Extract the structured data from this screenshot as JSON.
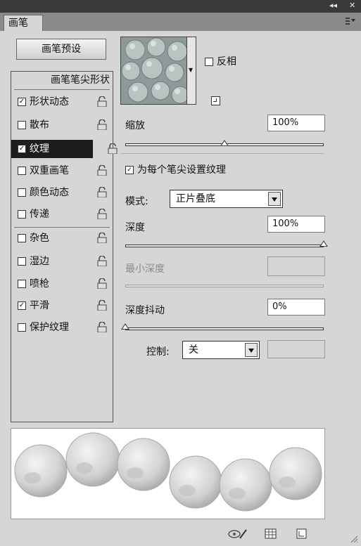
{
  "window": {
    "collapse_glyph": "◂◂",
    "close_glyph": "✕"
  },
  "tab": {
    "label": "画笔"
  },
  "menu_icon": "panel-menu-icon",
  "presets_button": "画笔预设",
  "brush_tip_header": "画笔笔尖形状",
  "options": [
    {
      "label": "形状动态",
      "checked": true
    },
    {
      "label": "散布",
      "checked": false
    },
    {
      "label": "纹理",
      "checked": true,
      "selected": true
    },
    {
      "label": "双重画笔",
      "checked": false
    },
    {
      "label": "颜色动态",
      "checked": false
    },
    {
      "label": "传递",
      "checked": false
    },
    {
      "label": "杂色",
      "checked": false
    },
    {
      "label": "湿边",
      "checked": false
    },
    {
      "label": "喷枪",
      "checked": false
    },
    {
      "label": "平滑",
      "checked": true
    },
    {
      "label": "保护纹理",
      "checked": false
    }
  ],
  "invert": {
    "label": "反相",
    "checked": false
  },
  "scale": {
    "label": "缩放",
    "value": "100%",
    "level": 0.5
  },
  "texture_each_tip": {
    "label": "为每个笔尖设置纹理",
    "checked": true
  },
  "mode": {
    "label": "模式:",
    "value": "正片叠底"
  },
  "depth": {
    "label": "深度",
    "value": "100%",
    "level": 1.0
  },
  "min_depth": {
    "label": "最小深度",
    "value": ""
  },
  "depth_jitter": {
    "label": "深度抖动",
    "value": "0%",
    "level": 0.0
  },
  "control": {
    "label": "控制:",
    "value": "关",
    "field": ""
  }
}
